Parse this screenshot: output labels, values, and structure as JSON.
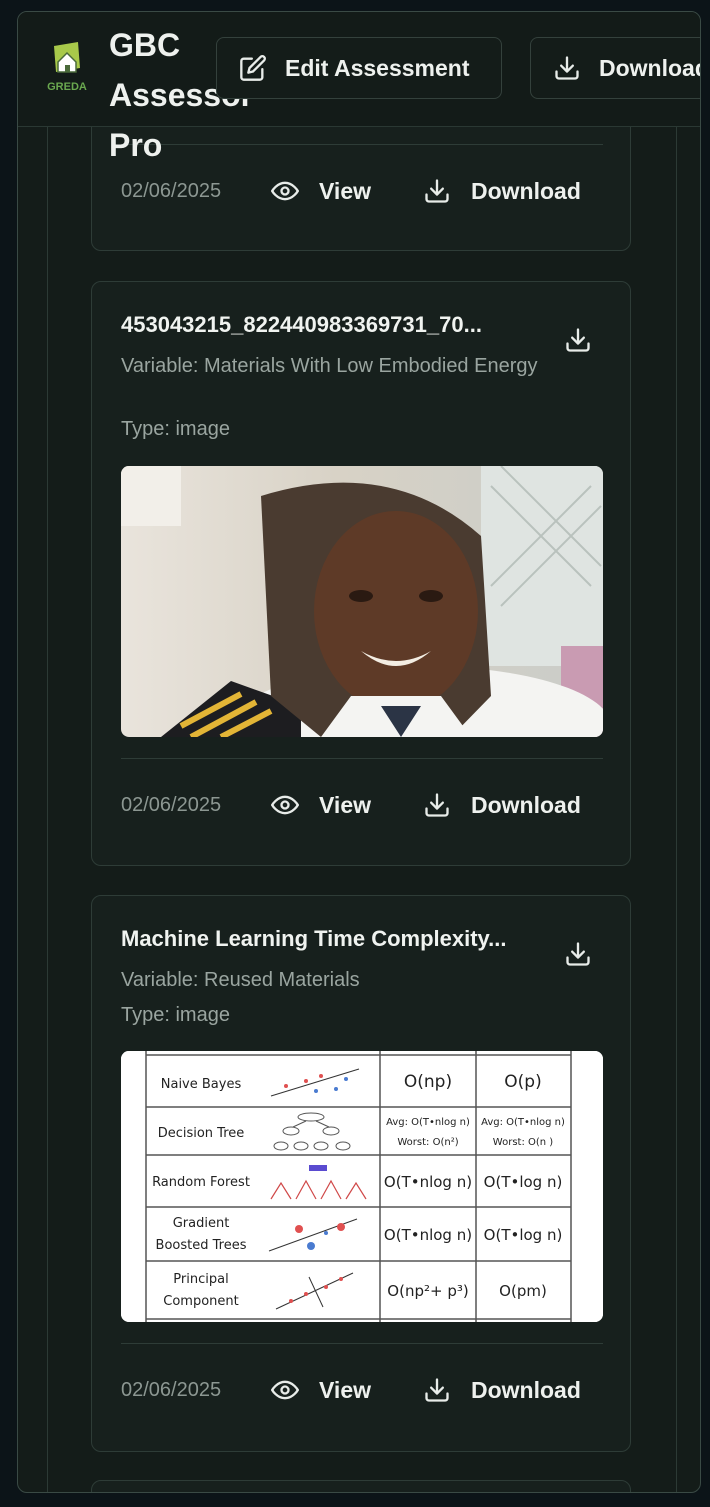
{
  "header": {
    "app_title": "GBC Assessor Pro",
    "logo_text": "GREDA",
    "edit_button_label": "Edit Assessment",
    "download_button_label": "Download"
  },
  "cards": [
    {
      "date": "02/06/2025",
      "view_label": "View",
      "download_label": "Download"
    },
    {
      "title": "453043215_822440983369731_70...",
      "variable": "Variable: Materials With Low Embodied Energy",
      "type": "Type: image",
      "date": "02/06/2025",
      "view_label": "View",
      "download_label": "Download"
    },
    {
      "title": "Machine Learning Time Complexity...",
      "variable": "Variable: Reused Materials",
      "type": "Type: image",
      "date": "02/06/2025",
      "view_label": "View",
      "download_label": "Download",
      "table_rows": [
        {
          "name": "Naive Bayes",
          "train": "O(np)",
          "predict": "O(p)"
        },
        {
          "name": "Decision Tree",
          "train_avg": "Avg: O(T•nlog n)",
          "train_worst": "Worst: O(n²)",
          "pred_avg": "Avg: O(T•nlog n)",
          "pred_worst": "Worst: O(n )"
        },
        {
          "name": "Random Forest",
          "train": "O(T•nlog n)",
          "predict": "O(T•log n)"
        },
        {
          "name_1": "Gradient",
          "name_2": "Boosted Trees",
          "train": "O(T•nlog n)",
          "predict": "O(T•log n)"
        },
        {
          "name_1": "Principal",
          "name_2": "Component",
          "train": "O(np²+ p³)",
          "predict": "O(pm)"
        }
      ]
    }
  ],
  "colors": {
    "background": "#0c1418",
    "card": "#17201d",
    "border": "#2e3c37",
    "logo_green": "#6aa84f"
  }
}
